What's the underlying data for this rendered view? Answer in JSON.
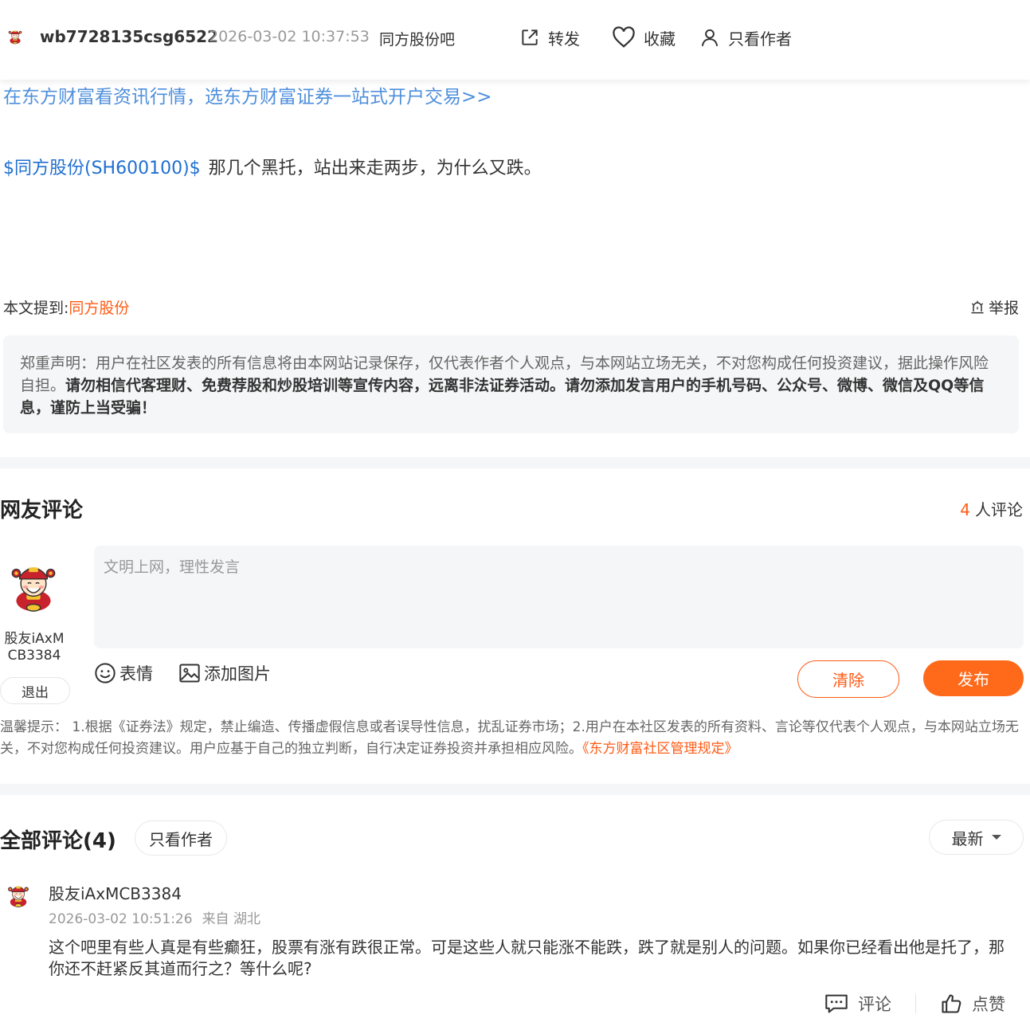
{
  "header": {
    "username": "wb7728135csg6522",
    "timestamp": "2026-03-02 10:37:53",
    "bar_name": "同方股份吧",
    "forward_label": "转发",
    "favorite_label": "收藏",
    "only_author_label": "只看作者"
  },
  "post": {
    "promo_link": "在东方财富看资讯行情，选东方财富证券一站式开户交易>>",
    "stock_tag": "$同方股份(SH600100)$",
    "text": "那几个黑托，站出来走两步，为什么又跌。",
    "mention_label": "本文提到:",
    "mention_stock": "同方股份",
    "report_label": "举报",
    "disclaimer_normal": "郑重声明：用户在社区发表的所有信息将由本网站记录保存，仅代表作者个人观点，与本网站立场无关，不对您构成任何投资建议，据此操作风险自担。",
    "disclaimer_bold": "请勿相信代客理财、免费荐股和炒股培训等宣传内容，远离非法证券活动。请勿添加发言用户的手机号码、公众号、微博、微信及QQ等信息，谨防上当受骗！"
  },
  "comment_box": {
    "title": "网友评论",
    "count": "4",
    "count_suffix": "人评论",
    "current_user": "股友iAxMCB3384",
    "logout_label": "退出",
    "placeholder": "文明上网，理性发言",
    "emoji_label": "表情",
    "image_label": "添加图片",
    "clear_label": "清除",
    "publish_label": "发布",
    "notice_text": "温馨提示： 1.根据《证券法》规定，禁止编造、传播虚假信息或者误导性信息，扰乱证券市场；2.用户在本社区发表的所有资料、言论等仅代表个人观点，与本网站立场无关，不对您构成任何投资建议。用户应基于自己的独立判断，自行决定证券投资并承担相应风险。",
    "notice_link": "《东方财富社区管理规定》"
  },
  "all_comments": {
    "title": "全部评论(4)",
    "only_author_label": "只看作者",
    "sort_label": "最新",
    "items": [
      {
        "user": "股友iAxMCB3384",
        "time": "2026-03-02 10:51:26",
        "location": "来自 湖北",
        "text": "这个吧里有些人真是有些癫狂，股票有涨有跌很正常。可是这些人就只能涨不能跌，跌了就是别人的问题。如果你已经看出他是托了，那你还不赶紧反其道而行之？等什么呢?",
        "reply_label": "评论",
        "like_label": "点赞"
      }
    ]
  },
  "colors": {
    "accent": "#ff5a14",
    "link_blue": "#1f6fd1",
    "promo_blue": "#4f8fdb",
    "panel_bg": "#f5f6f7"
  },
  "icons": [
    "avatar-icon",
    "share-icon",
    "heart-icon",
    "user-icon",
    "report-icon",
    "emoji-icon",
    "image-icon",
    "comment-icon",
    "thumb-up-icon"
  ]
}
